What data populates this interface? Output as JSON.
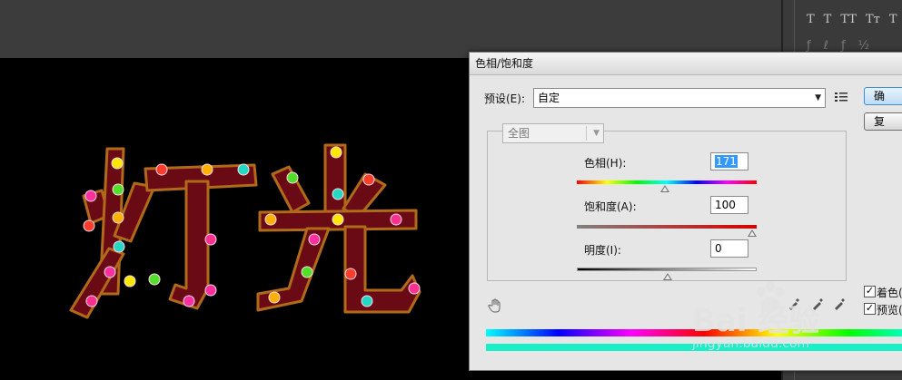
{
  "app": {
    "right_panel": {
      "type_buttons": [
        "T",
        "T",
        "TT",
        "Tт",
        "T"
      ]
    }
  },
  "canvas": {
    "text": "灯光",
    "letter_color": "#6a0a14",
    "bulb_colors": [
      "#ff2fa0",
      "#ffe800",
      "#53e02a",
      "#ff3d2a",
      "#ffb000",
      "#25d8c4",
      "#ff3090"
    ]
  },
  "dialog": {
    "title": "色相/饱和度",
    "preset": {
      "label": "预设(E):",
      "value": "自定"
    },
    "ok_button": "确",
    "reset_button": "复",
    "channel": {
      "value": "全图"
    },
    "hue": {
      "label": "色相(H):",
      "value": "171",
      "slider_fraction": 0.475
    },
    "saturation": {
      "label": "饱和度(A):",
      "value": "100",
      "slider_fraction": 1.0
    },
    "lightness": {
      "label": "明度(I):",
      "value": "0",
      "slider_fraction": 0.5
    },
    "colorize": {
      "label": "着色(",
      "checked": true
    },
    "preview": {
      "label": "预览(",
      "checked": true
    }
  },
  "watermark": {
    "line1": "Bai 经验",
    "line2": "jingyan.baidu.com"
  }
}
